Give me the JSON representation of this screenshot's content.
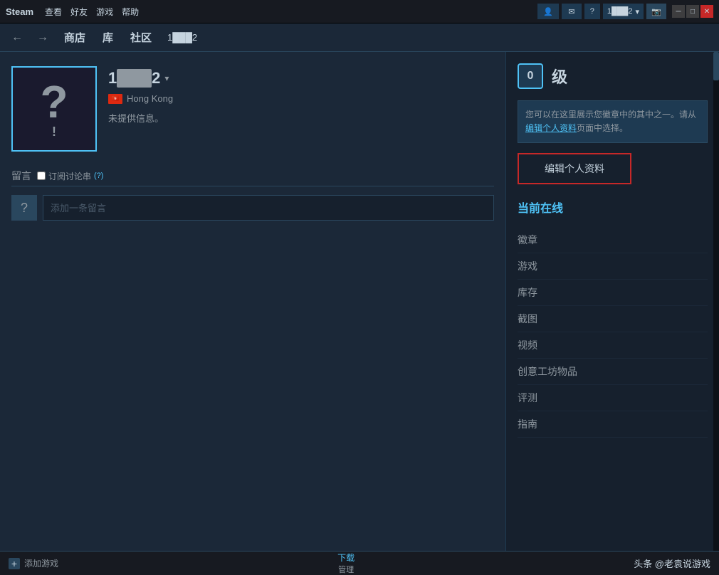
{
  "titlebar": {
    "steam_label": "Steam",
    "menu_items": [
      "查看",
      "好友",
      "游戏",
      "帮助"
    ],
    "user_label": "1███2",
    "help_label": "?",
    "minimize_label": "─",
    "maximize_label": "□",
    "close_label": "✕"
  },
  "navbar": {
    "back_arrow": "←",
    "forward_arrow": "→",
    "store_label": "商店",
    "library_label": "库",
    "community_label": "社区",
    "breadcrumb_label": "1███2"
  },
  "profile": {
    "username": "1",
    "username_blur": "████",
    "username_suffix": "2",
    "dropdown_arrow": "▾",
    "location": "Hong Kong",
    "bio": "未提供信息。"
  },
  "level": {
    "badge_value": "0",
    "level_label": "级"
  },
  "info_box": {
    "text_before": "您可以在这里展示您徽章中的其中之一。请从",
    "link_text": "编辑个人资料",
    "text_after": "页面中选择。"
  },
  "edit_button": {
    "label": "编辑个人资料"
  },
  "online_status": {
    "label": "当前在线"
  },
  "right_nav": {
    "items": [
      "徽章",
      "游戏",
      "库存",
      "截图",
      "视频",
      "创意工坊物品",
      "评测",
      "指南"
    ]
  },
  "comments": {
    "title": "留言",
    "subscribe_label": "订阅讨论串",
    "help_label": "(?)",
    "placeholder": "添加一条留言",
    "avatar_label": "?"
  },
  "bottom": {
    "add_game_label": "添加游戏",
    "download_label": "下载",
    "manage_label": "管理",
    "watermark_prefix": "头条 @老袁说游戏"
  }
}
